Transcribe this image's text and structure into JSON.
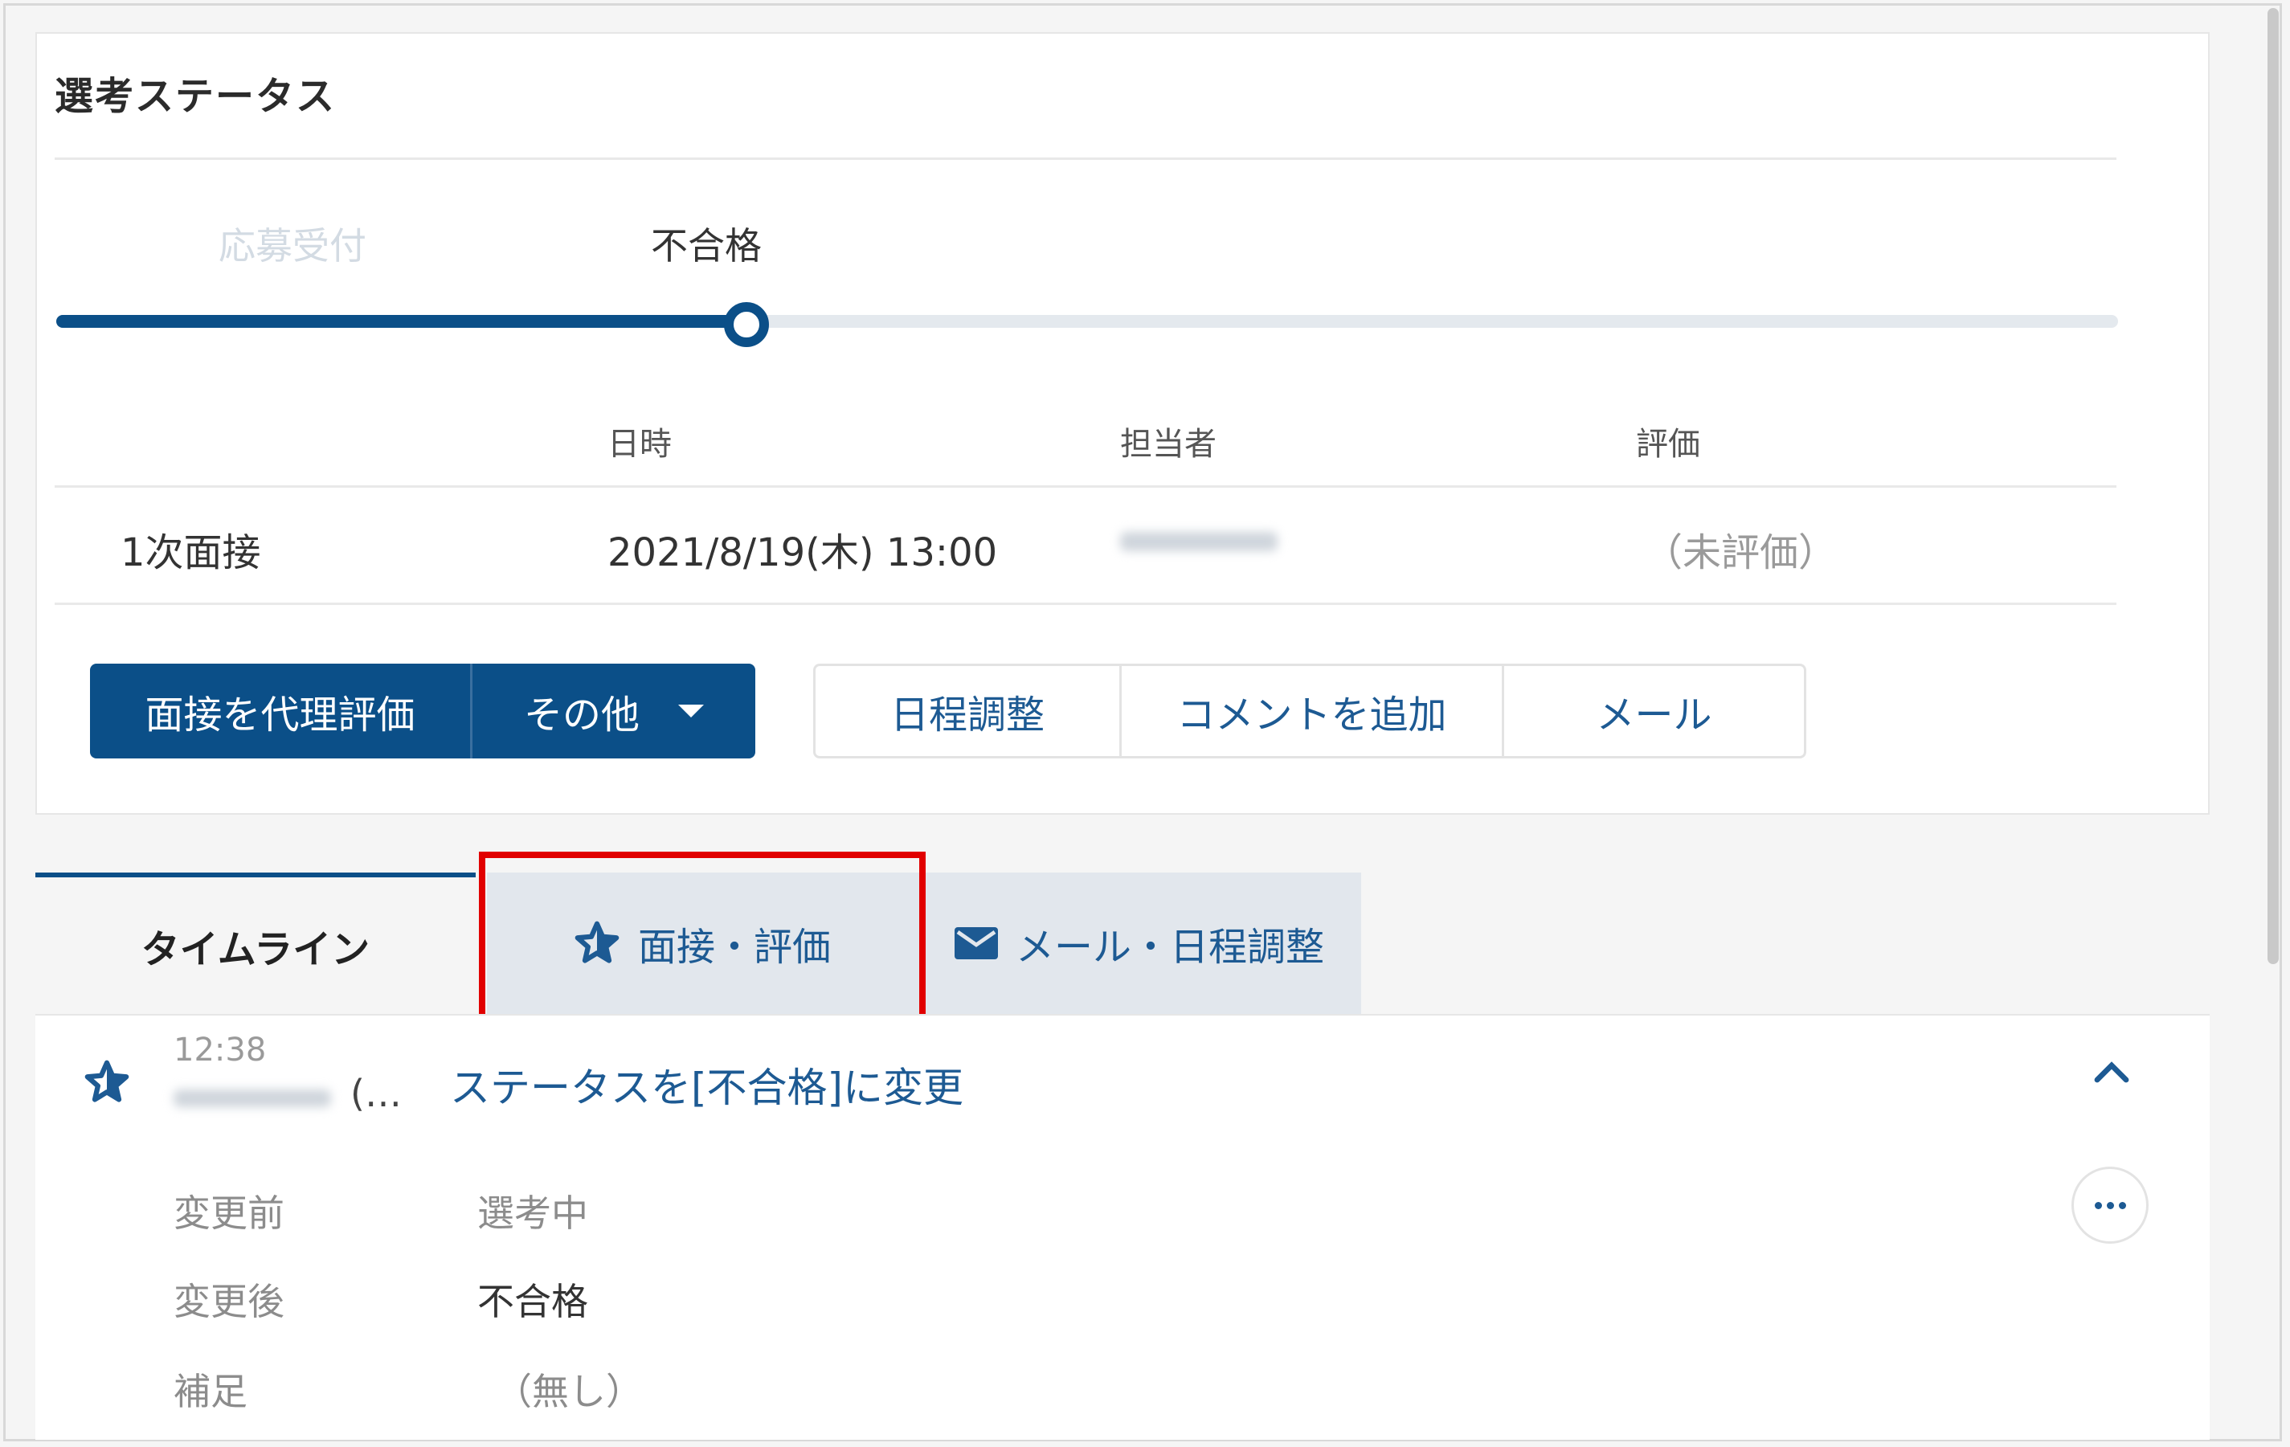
{
  "colors": {
    "primary": "#0b4f88",
    "link": "#1d5a93",
    "highlight": "#e10000"
  },
  "status_card": {
    "title": "選考ステータス",
    "steps": {
      "done": "応募受付",
      "current": "不合格"
    },
    "progress_percent": 33
  },
  "schedule_table": {
    "headers": {
      "datetime": "日時",
      "assignee": "担当者",
      "evaluation": "評価"
    },
    "row": {
      "stage": "1次面接",
      "datetime": "2021/8/19(木) 13:00",
      "evaluation": "（未評価）"
    }
  },
  "actions": {
    "proxy_evaluate": "面接を代理評価",
    "other": "その他",
    "schedule": "日程調整",
    "add_comment": "コメントを追加",
    "mail": "メール"
  },
  "tabs": {
    "timeline": "タイムライン",
    "interview": "面接・評価",
    "mail": "メール・日程調整"
  },
  "timeline": {
    "time": "12:38",
    "author_suffix": "(…",
    "title": "ステータスを[不合格]に変更",
    "details": {
      "before_label": "変更前",
      "before_value": "選考中",
      "after_label": "変更後",
      "after_value": "不合格",
      "note_label": "補足",
      "note_value": "（無し）"
    }
  },
  "icons": {
    "tab_interview": "star-outline-icon",
    "tab_mail": "envelope-icon",
    "timeline_entry": "star-outline-icon",
    "collapse": "chevron-up-icon",
    "more": "more-horizontal-icon",
    "dropdown": "caret-down-icon"
  }
}
